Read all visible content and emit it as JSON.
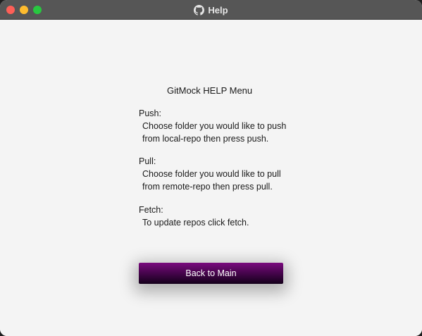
{
  "window": {
    "title": "Help",
    "title_icon": "github-icon"
  },
  "help": {
    "heading": "GitMock HELP Menu",
    "push": {
      "label": "Push:",
      "lines": [
        "Choose folder you would like to push",
        "from local-repo then press push."
      ]
    },
    "pull": {
      "label": "Pull:",
      "lines": [
        "Choose folder you would like to pull",
        "from remote-repo then press pull."
      ]
    },
    "fetch": {
      "label": "Fetch:",
      "lines": [
        "To update repos click fetch."
      ]
    }
  },
  "actions": {
    "back_label": "Back to Main"
  },
  "colors": {
    "titlebar": "#565656",
    "background": "#f4f4f4",
    "button_top": "#7a0a7e",
    "button_bottom": "#14001a",
    "close": "#fe5f57",
    "minimize": "#febc2e",
    "zoom": "#28c840"
  }
}
